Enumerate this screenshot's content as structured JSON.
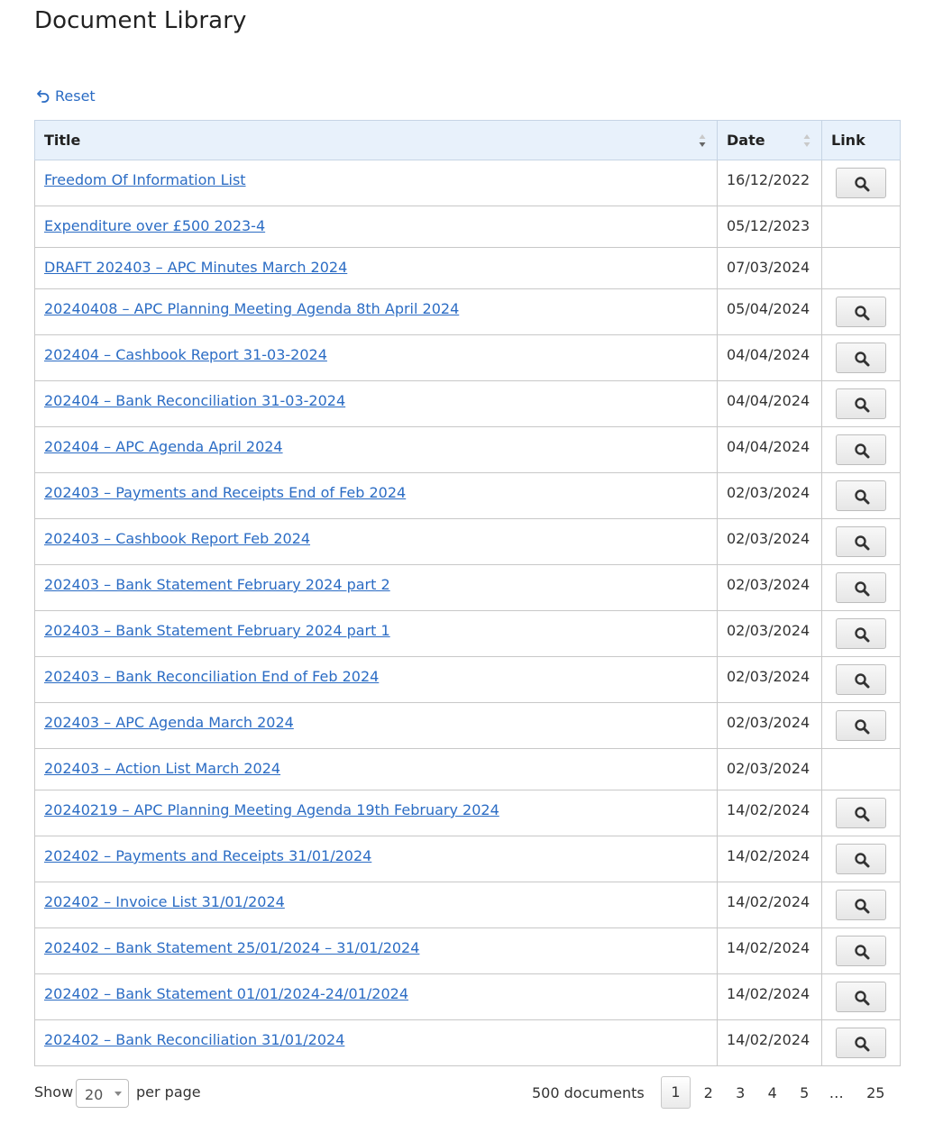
{
  "page": {
    "title": "Document Library"
  },
  "toolbar": {
    "reset_label": "Reset"
  },
  "table": {
    "columns": {
      "title": "Title",
      "date": "Date",
      "link": "Link"
    },
    "rows": [
      {
        "title": "Freedom Of Information List",
        "date": "16/12/2022",
        "has_link": true
      },
      {
        "title": "Expenditure over £500 2023-4",
        "date": "05/12/2023",
        "has_link": false
      },
      {
        "title": "DRAFT 202403 – APC Minutes March 2024",
        "date": "07/03/2024",
        "has_link": false
      },
      {
        "title": "20240408 – APC Planning Meeting Agenda 8th April 2024",
        "date": "05/04/2024",
        "has_link": true
      },
      {
        "title": "202404 – Cashbook Report 31-03-2024",
        "date": "04/04/2024",
        "has_link": true
      },
      {
        "title": "202404 – Bank Reconciliation 31-03-2024",
        "date": "04/04/2024",
        "has_link": true
      },
      {
        "title": "202404 – APC Agenda April 2024",
        "date": "04/04/2024",
        "has_link": true
      },
      {
        "title": "202403 – Payments and Receipts End of Feb 2024",
        "date": "02/03/2024",
        "has_link": true
      },
      {
        "title": "202403 – Cashbook Report Feb 2024",
        "date": "02/03/2024",
        "has_link": true
      },
      {
        "title": "202403 – Bank Statement February 2024 part 2",
        "date": "02/03/2024",
        "has_link": true
      },
      {
        "title": "202403 – Bank Statement February 2024 part 1",
        "date": "02/03/2024",
        "has_link": true
      },
      {
        "title": "202403 – Bank Reconciliation End of Feb 2024",
        "date": "02/03/2024",
        "has_link": true
      },
      {
        "title": "202403 – APC Agenda March 2024",
        "date": "02/03/2024",
        "has_link": true
      },
      {
        "title": "202403 – Action List March 2024",
        "date": "02/03/2024",
        "has_link": false
      },
      {
        "title": "20240219 – APC Planning Meeting Agenda 19th February 2024",
        "date": "14/02/2024",
        "has_link": true
      },
      {
        "title": "202402 – Payments and Receipts 31/01/2024",
        "date": "14/02/2024",
        "has_link": true
      },
      {
        "title": "202402 – Invoice List 31/01/2024",
        "date": "14/02/2024",
        "has_link": true
      },
      {
        "title": "202402 – Bank Statement 25/01/2024 – 31/01/2024",
        "date": "14/02/2024",
        "has_link": true
      },
      {
        "title": "202402 – Bank Statement 01/01/2024-24/01/2024",
        "date": "14/02/2024",
        "has_link": true
      },
      {
        "title": "202402 – Bank Reconciliation 31/01/2024",
        "date": "14/02/2024",
        "has_link": true
      }
    ],
    "link_icon": "search-icon"
  },
  "footer": {
    "show_label": "Show",
    "per_page_value": "20",
    "per_page_label": "per page",
    "count_label": "500 documents",
    "pages": [
      "1",
      "2",
      "3",
      "4",
      "5",
      "…",
      "25"
    ],
    "current_page": "1"
  },
  "colors": {
    "link": "#2b6cc4",
    "header_bg": "#e8f1fb",
    "border": "#c8c8c8"
  }
}
